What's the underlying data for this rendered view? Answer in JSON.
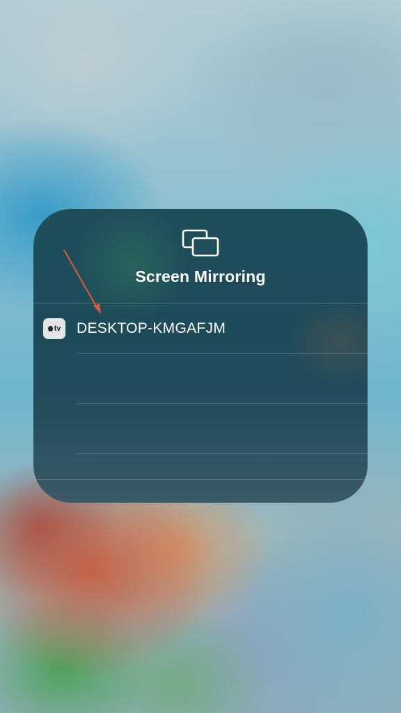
{
  "screen_mirroring": {
    "icon": "screen-mirroring-icon",
    "title": "Screen Mirroring",
    "devices": [
      {
        "badge_icon": "apple-tv-icon",
        "badge_label": "tv",
        "name": "DESKTOP-KMGAFJM"
      }
    ]
  },
  "annotation": {
    "arrow_color": "#e05a3a"
  }
}
